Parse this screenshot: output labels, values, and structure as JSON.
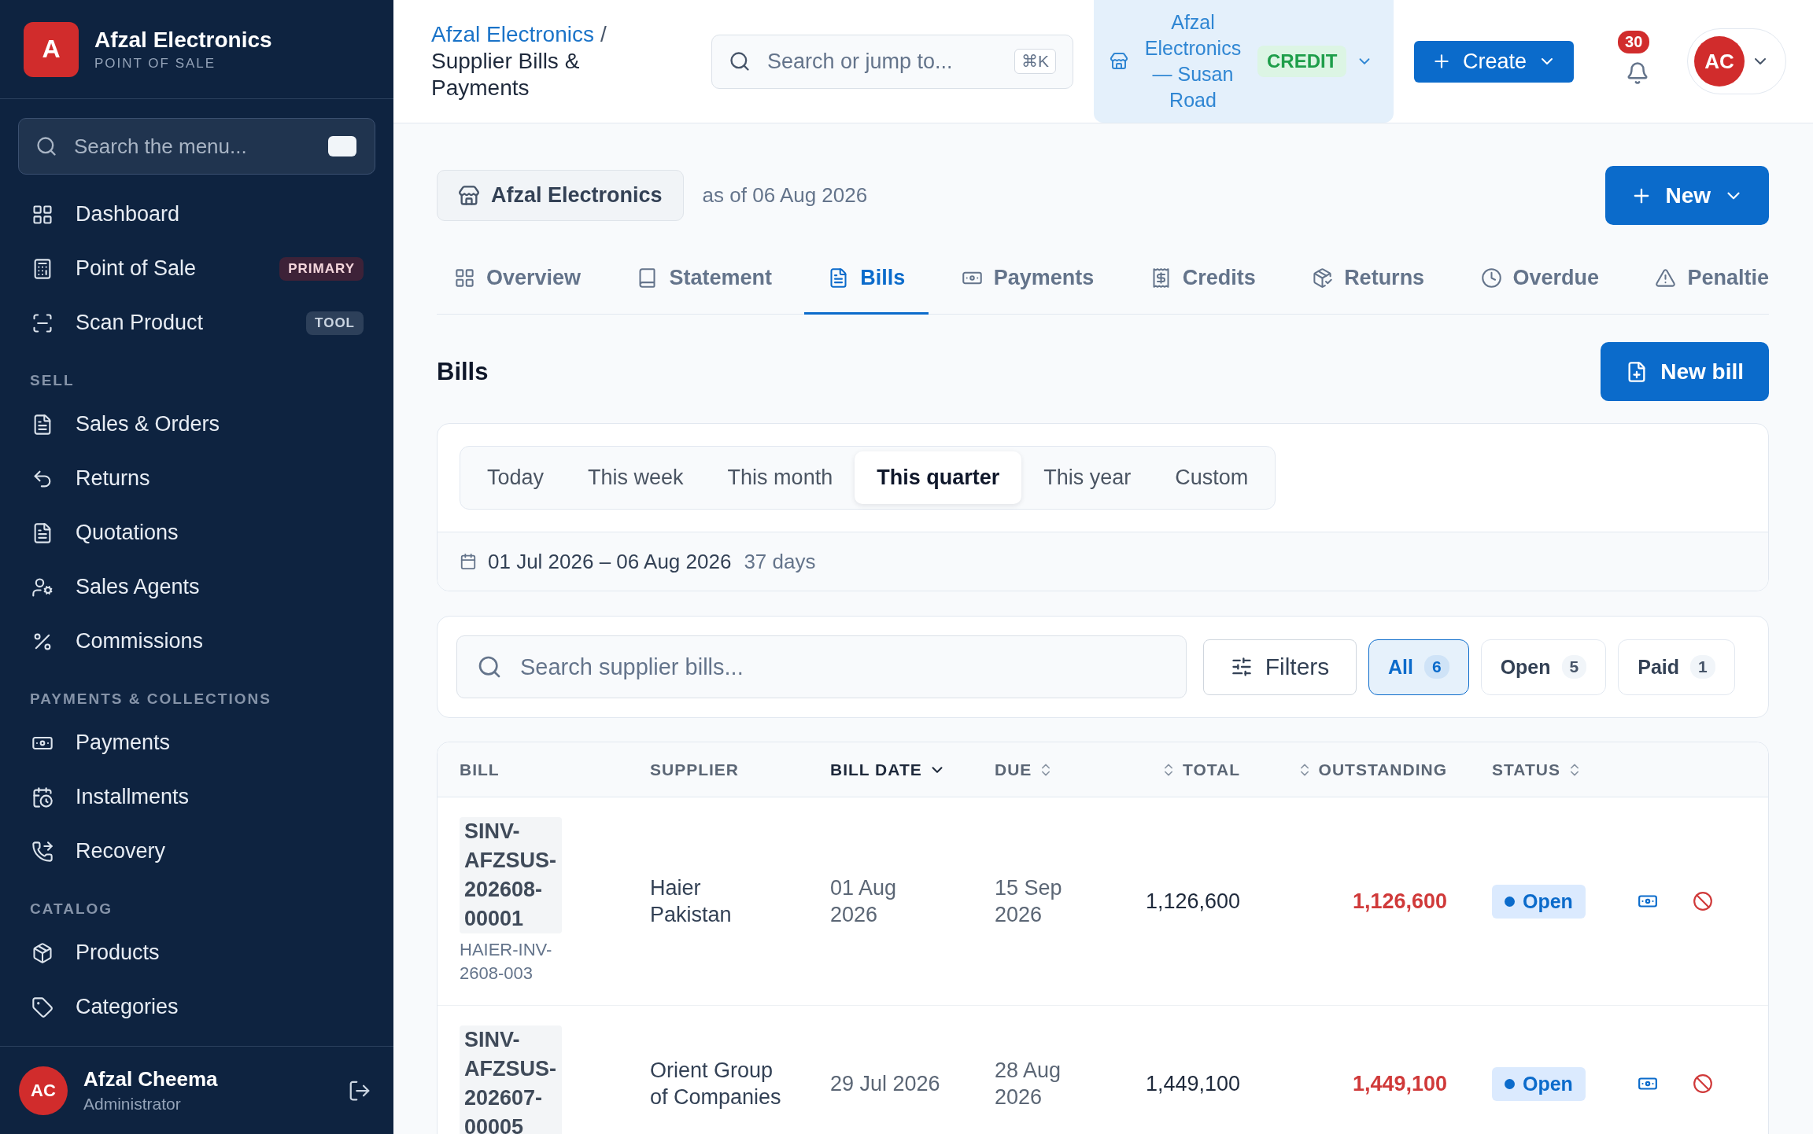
{
  "sidebar": {
    "brand": {
      "logo": "A",
      "name": "Afzal Electronics",
      "subtitle": "POINT OF SALE"
    },
    "search": {
      "placeholder": "Search the menu..."
    },
    "sections": [
      {
        "items": [
          {
            "label": "Dashboard"
          },
          {
            "label": "Point of Sale",
            "badge": {
              "text": "PRIMARY",
              "kind": "primary"
            }
          },
          {
            "label": "Scan Product",
            "badge": {
              "text": "TOOL",
              "kind": "tool"
            }
          }
        ]
      },
      {
        "label": "SELL",
        "items": [
          {
            "label": "Sales & Orders"
          },
          {
            "label": "Returns"
          },
          {
            "label": "Quotations"
          },
          {
            "label": "Sales Agents"
          },
          {
            "label": "Commissions"
          }
        ]
      },
      {
        "label": "PAYMENTS & COLLECTIONS",
        "items": [
          {
            "label": "Payments"
          },
          {
            "label": "Installments"
          },
          {
            "label": "Recovery"
          }
        ]
      },
      {
        "label": "CATALOG",
        "items": [
          {
            "label": "Products"
          },
          {
            "label": "Categories"
          }
        ]
      }
    ],
    "user": {
      "initials": "AC",
      "name": "Afzal Cheema",
      "role": "Administrator"
    }
  },
  "header": {
    "breadcrumb": {
      "parent": "Afzal Electronics",
      "separator": "/",
      "current": "Supplier Bills & Payments"
    },
    "search": {
      "placeholder": "Search or jump to...",
      "shortcut": "⌘K"
    },
    "store": {
      "name": "Afzal Electronics — Susan Road",
      "mode": "CREDIT"
    },
    "create_button": "Create",
    "notifications": {
      "count": "30"
    },
    "avatar": {
      "initials": "AC"
    }
  },
  "org_chip": "Afzal Electronics",
  "as_of": "as of 06 Aug 2026",
  "new_button": "New",
  "tabs": [
    {
      "label": "Overview",
      "selected": false
    },
    {
      "label": "Statement",
      "selected": false
    },
    {
      "label": "Bills",
      "selected": true
    },
    {
      "label": "Payments",
      "selected": false
    },
    {
      "label": "Credits",
      "selected": false
    },
    {
      "label": "Returns",
      "selected": false
    },
    {
      "label": "Overdue",
      "selected": false
    },
    {
      "label": "Penaltie",
      "selected": false
    }
  ],
  "section_title": "Bills",
  "new_bill_button": "New bill",
  "period": {
    "presets": [
      {
        "label": "Today",
        "selected": false
      },
      {
        "label": "This week",
        "selected": false
      },
      {
        "label": "This month",
        "selected": false
      },
      {
        "label": "This quarter",
        "selected": true
      },
      {
        "label": "This year",
        "selected": false
      },
      {
        "label": "Custom",
        "selected": false
      }
    ],
    "range": "01 Jul 2026 – 06 Aug 2026",
    "days": "37 days"
  },
  "filters": {
    "search_placeholder": "Search supplier bills...",
    "filters_button": "Filters",
    "status_tabs": [
      {
        "label": "All",
        "count": "6",
        "selected": true
      },
      {
        "label": "Open",
        "count": "5",
        "selected": false
      },
      {
        "label": "Paid",
        "count": "1",
        "selected": false
      }
    ]
  },
  "table": {
    "columns": [
      {
        "label": "BILL",
        "sortable": false,
        "sorted": false
      },
      {
        "label": "SUPPLIER",
        "sortable": false,
        "sorted": false
      },
      {
        "label": "BILL DATE",
        "sortable": true,
        "sorted": true
      },
      {
        "label": "DUE",
        "sortable": true,
        "sorted": false
      },
      {
        "label": "TOTAL",
        "sortable": true,
        "sorted": false
      },
      {
        "label": "OUTSTANDING",
        "sortable": true,
        "sorted": false
      },
      {
        "label": "STATUS",
        "sortable": true,
        "sorted": false
      }
    ],
    "rows": [
      {
        "bill": "SINV-AFZSUS-202608-00001",
        "reference": "HAIER-INV-2608-003",
        "supplier": "Haier Pakistan",
        "bill_date": "01 Aug 2026",
        "due": "15 Sep 2026",
        "total": "1,126,600",
        "outstanding": "1,126,600",
        "status": "Open"
      },
      {
        "bill": "SINV-AFZSUS-202607-00005",
        "supplier": "Orient Group of Companies",
        "bill_date": "29 Jul 2026",
        "due": "28 Aug 2026",
        "total": "1,449,100",
        "outstanding": "1,449,100",
        "status": "Open"
      }
    ]
  }
}
